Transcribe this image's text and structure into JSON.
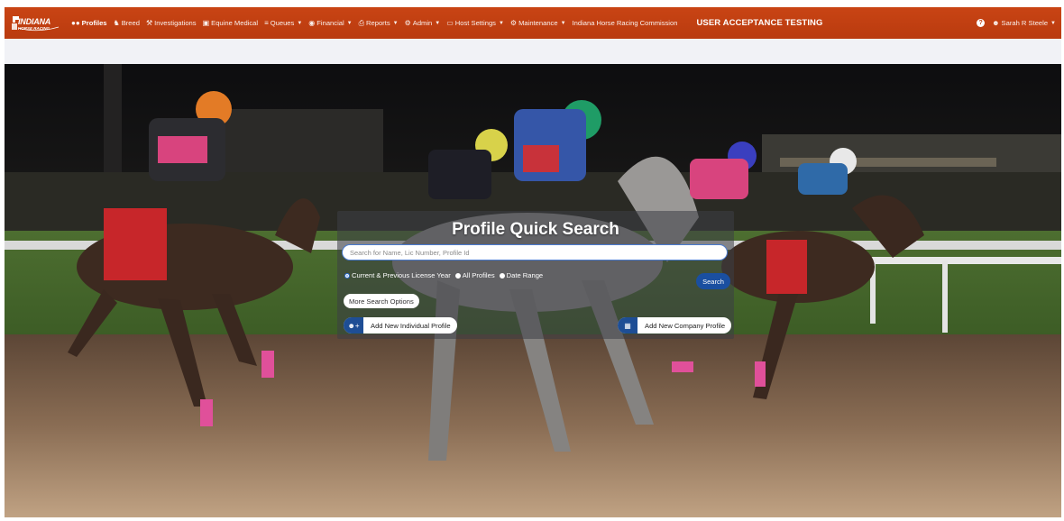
{
  "app": {
    "logo_title": "INDIANA",
    "logo_subtitle": "HORSE RACING"
  },
  "nav": {
    "items": [
      {
        "label": "Profiles",
        "icon": "users-icon",
        "active": true,
        "caret": false
      },
      {
        "label": "Breed",
        "icon": "horse-icon",
        "caret": false
      },
      {
        "label": "Investigations",
        "icon": "gavel-icon",
        "caret": false
      },
      {
        "label": "Equine Medical",
        "icon": "medkit-icon",
        "caret": false
      },
      {
        "label": "Queues",
        "icon": "list-icon",
        "caret": true
      },
      {
        "label": "Financial",
        "icon": "dollar-icon",
        "caret": true
      },
      {
        "label": "Reports",
        "icon": "print-icon",
        "caret": true
      },
      {
        "label": "Admin",
        "icon": "gears-icon",
        "caret": true
      },
      {
        "label": "Host Settings",
        "icon": "monitor-icon",
        "caret": true
      },
      {
        "label": "Maintenance",
        "icon": "gear-icon",
        "caret": true
      },
      {
        "label": "Indiana Horse Racing Commission",
        "icon": "",
        "caret": false
      }
    ],
    "environment_label": "USER ACCEPTANCE TESTING",
    "user_name": "Sarah R Steele",
    "help_icon": "question-circle-icon",
    "user_icon": "user-icon"
  },
  "search": {
    "title": "Profile Quick Search",
    "placeholder": "Search for Name, Lic Number, Profile Id",
    "value": "",
    "options": [
      {
        "label": "Current & Previous License Year",
        "selected": true
      },
      {
        "label": "All Profiles",
        "selected": false
      },
      {
        "label": "Date Range",
        "selected": false
      }
    ],
    "search_button": "Search",
    "more_options_button": "More Search Options",
    "add_individual_button": "Add New Individual Profile",
    "add_company_button": "Add New Company Profile"
  },
  "colors": {
    "navbar": "#c24010",
    "accent": "#1a4fa0",
    "subbar": "#f1f2f6"
  }
}
